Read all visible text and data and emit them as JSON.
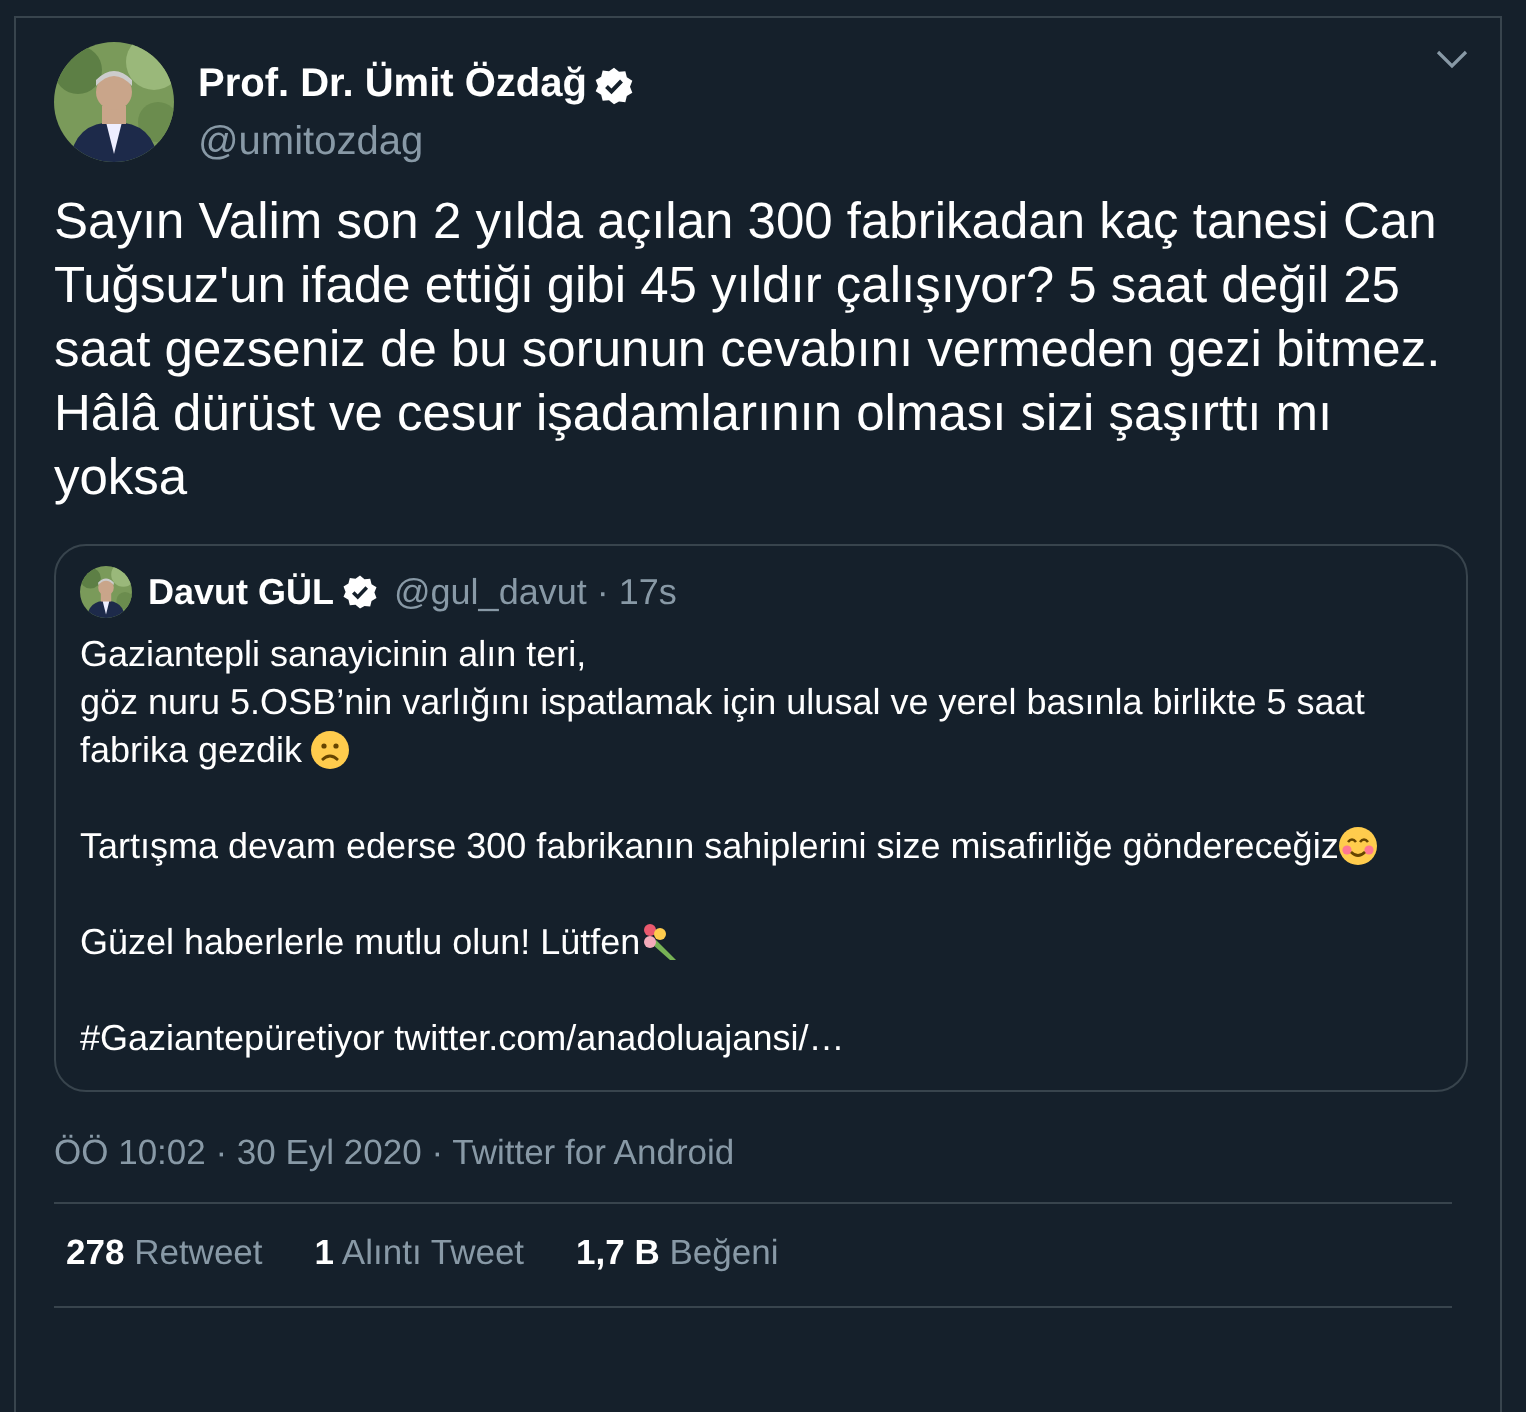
{
  "author": {
    "name": "Prof. Dr. Ümit Özdağ",
    "verified": true,
    "handle": "@umitozdag"
  },
  "text": "Sayın Valim son 2 yılda açılan 300 fabrikadan kaç tanesi Can Tuğsuz'un ifade ettiği gibi 45 yıldır çalışıyor? 5 saat değil 25 saat gezseniz de bu sorunun cevabını vermeden gezi bitmez. Hâlâ dürüst ve cesur işadamlarının olması sizi şaşırttı mı yoksa",
  "quote": {
    "name": "Davut GÜL",
    "verified": true,
    "meta": "@gul_davut · 17s",
    "paragraphs": [
      {
        "lines": [
          "Gaziantepli sanayicinin alın teri,",
          "göz nuru 5.OSB’nin varlığını ispatlamak için ulusal ve yerel basınla birlikte 5 saat",
          "fabrika gezdik"
        ],
        "kind": "frown"
      },
      {
        "lines": [
          "Tartışma devam ederse 300 fabrikanın sahiplerini size misafirliğe göndereceğiz"
        ],
        "kind": "smile"
      },
      {
        "lines": [
          "Güzel haberlerle mutlu olun! Lütfen"
        ],
        "kind": "bouquet"
      },
      {
        "lines": [
          "#Gaziantepüretiyor twitter.com/anadoluajansi/…"
        ],
        "kind": "plain"
      }
    ]
  },
  "meta": "ÖÖ 10:02 · 30 Eyl 2020 · Twitter for Android",
  "stats": [
    {
      "count": "278",
      "label": "Retweet"
    },
    {
      "count": "1",
      "label": "Alıntı Tweet"
    },
    {
      "count": "1,7 B",
      "label": "Beğeni"
    }
  ]
}
